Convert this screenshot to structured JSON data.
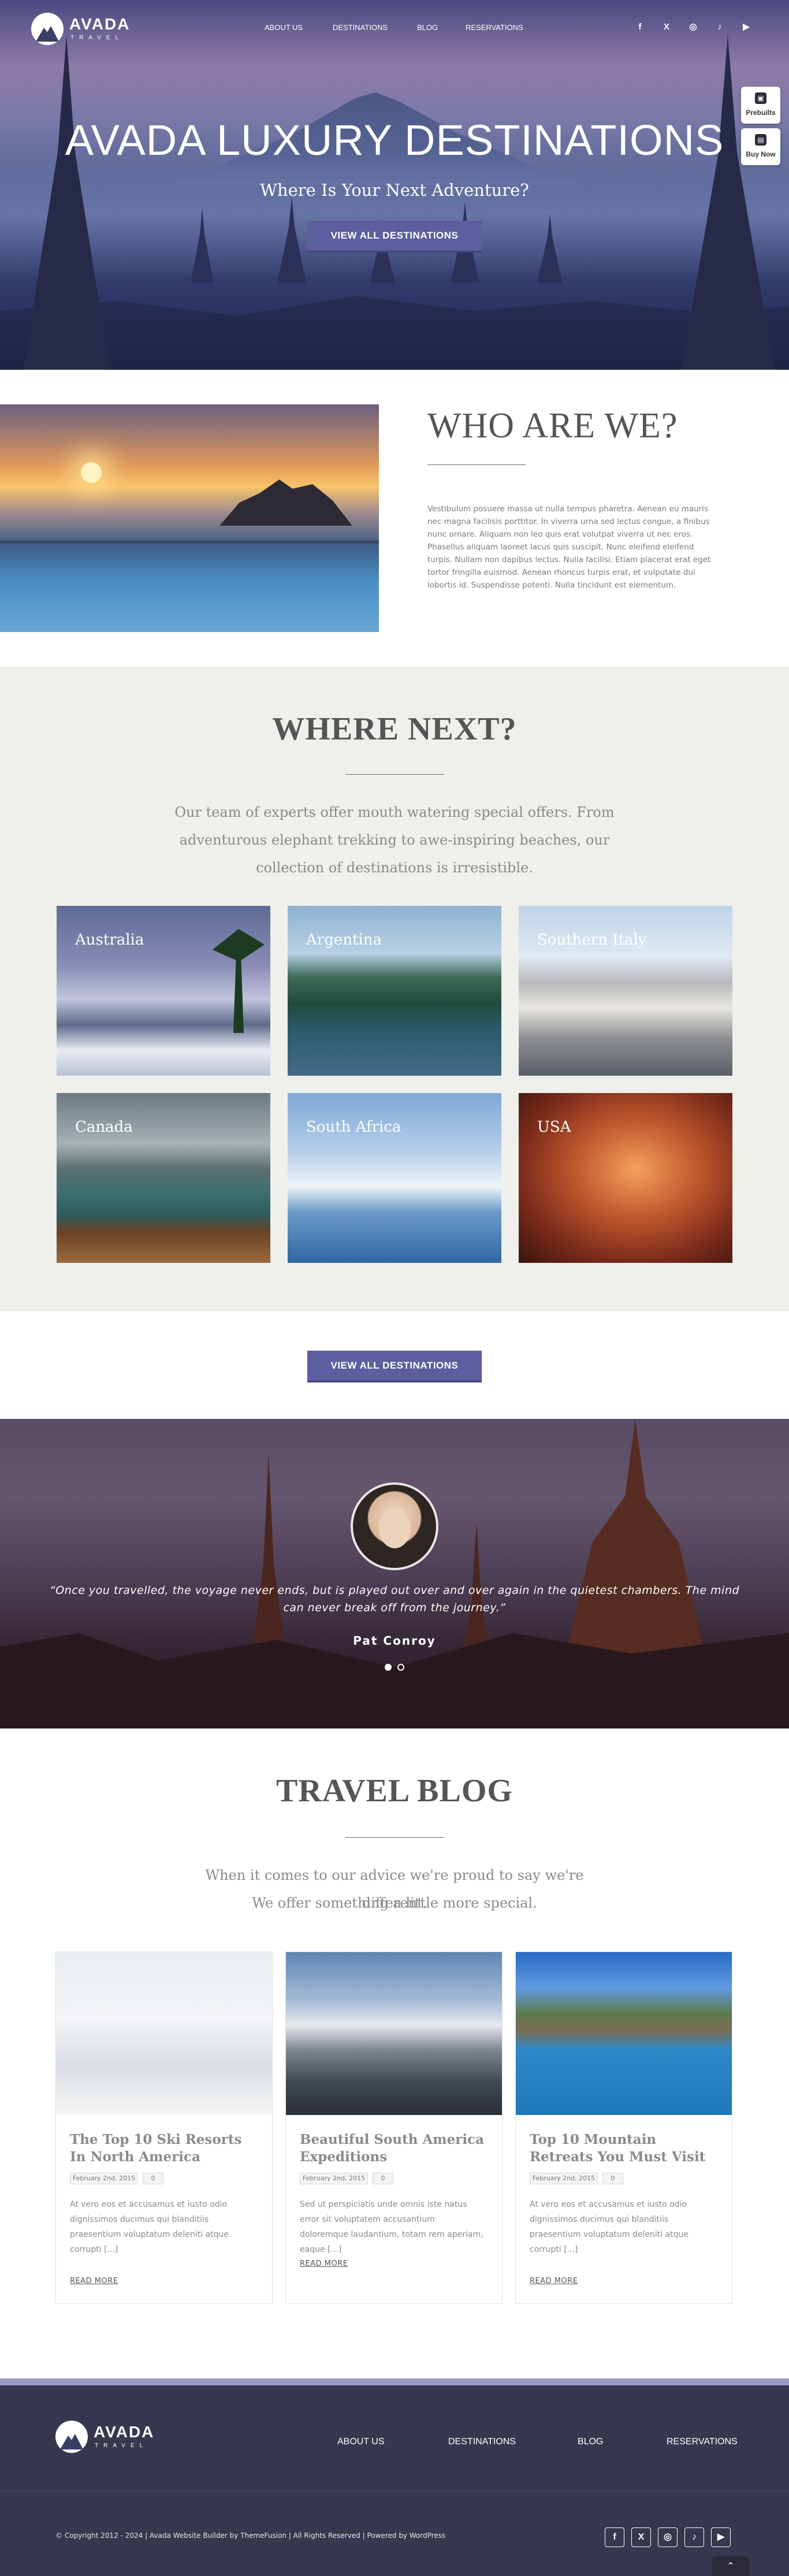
{
  "header": {
    "logo_text": "AVADA",
    "logo_sub": "TRAVEL",
    "nav": [
      "ABOUT US",
      "DESTINATIONS",
      "BLOG",
      "RESERVATIONS"
    ],
    "social": [
      "f",
      "X",
      "◎",
      "♪",
      "▶"
    ]
  },
  "hero": {
    "title": "AVADA LUXURY DESTINATIONS",
    "subtitle": "Where Is Your Next Adventure?",
    "button": "VIEW ALL DESTINATIONS"
  },
  "side_widgets": [
    {
      "label": "Prebuilts",
      "icon": "prebuilts-icon"
    },
    {
      "label": "Buy Now",
      "icon": "cart-icon"
    }
  ],
  "who": {
    "heading": "WHO ARE WE?",
    "text": "Vestibulum posuere massa ut nulla tempus pharetra. Aenean eu mauris nec magna facilisis porttitor. In viverra urna sed lectus congue, a finibus nunc ornare. Aliquam non leo quis erat volutpat viverra ut nec eros. Phasellus aliquam laoreet lacus quis suscipit. Nunc eleifend eleifend turpis. Nullam non dapibus lectus. Nulla facilisi. Etiam placerat erat eget tortor fringilla euismod. Aenean rhoncus turpis erat, et vulputate dui lobortis id. Suspendisse potenti. Nulla tincidunt est elementum."
  },
  "where": {
    "heading": "WHERE NEXT?",
    "intro": "Our team of experts offer mouth watering special offers. From adventurous elephant trekking to awe-inspiring beaches, our collection of destinations is irresistible.",
    "destinations": [
      "Australia",
      "Argentina",
      "Southern Italy",
      "Canada",
      "South Africa",
      "USA"
    ],
    "button": "VIEW ALL DESTINATIONS"
  },
  "testimonial": {
    "quote": "“Once you travelled, the voyage never ends, but is played out over and over again in the quietest chambers. The mind can never break off from the journey.”",
    "author": "Pat Conroy"
  },
  "blog": {
    "heading": "TRAVEL BLOG",
    "intro_line1": "When it comes to our advice we're proud to say we're different.",
    "intro_line2": "We offer something a little more special.",
    "posts": [
      {
        "title": "The Top 10 Ski Resorts In North America",
        "date": "February 2nd, 2015",
        "comments": "0",
        "excerpt": "At vero eos et accusamus et iusto odio dignissimos ducimus qui blanditiis praesentium voluptatum deleniti atque corrupti [...]",
        "more": "READ MORE"
      },
      {
        "title": "Beautiful South America Expeditions",
        "date": "February 2nd, 2015",
        "comments": "0",
        "excerpt": "Sed ut perspiciatis unde omnis iste natus error sit voluptatem accusantium doloremque laudantium, totam rem aperiam, eaque [...]",
        "more": "READ MORE"
      },
      {
        "title": "Top 10 Mountain Retreats You Must Visit",
        "date": "February 2nd, 2015",
        "comments": "0",
        "excerpt": "At vero eos et accusamus et iusto odio dignissimos ducimus qui blanditiis praesentium voluptatum deleniti atque corrupti [...]",
        "more": "READ MORE"
      }
    ]
  },
  "footer": {
    "logo_text": "AVADA",
    "logo_sub": "TRAVEL",
    "nav": [
      "ABOUT US",
      "DESTINATIONS",
      "BLOG",
      "RESERVATIONS"
    ],
    "copyright": "© Copyright 2012 - 2024 | Avada Website Builder by ThemeFusion | All Rights Reserved | Powered by WordPress",
    "social": [
      "f",
      "X",
      "◎",
      "♪",
      "▶"
    ]
  },
  "colors": {
    "accent": "#5d5e9e",
    "footer_bg": "#37374f",
    "section_bg": "#efefeb"
  }
}
